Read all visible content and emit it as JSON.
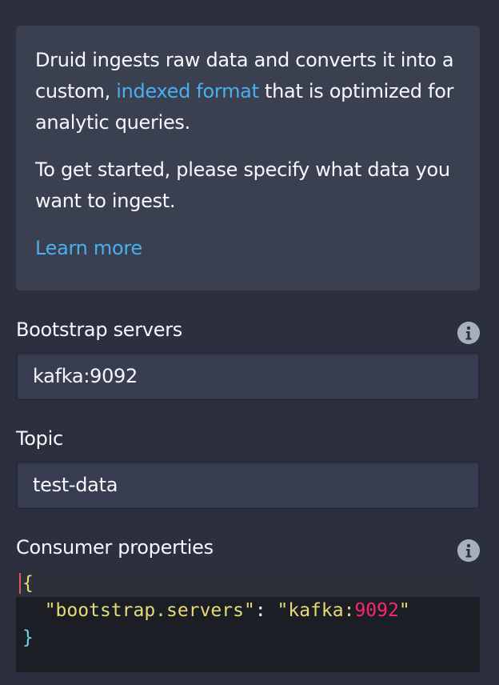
{
  "callout": {
    "intro_before_link": "Druid ingests raw data and converts it into a custom, ",
    "intro_link": "indexed format",
    "intro_after_link": " that is optimized for analytic queries.",
    "get_started": "To get started, please specify what data you want to ingest.",
    "learn_more": "Learn more"
  },
  "fields": {
    "bootstrap_servers": {
      "label": "Bootstrap servers",
      "value": "kafka:9092"
    },
    "topic": {
      "label": "Topic",
      "value": "test-data"
    },
    "consumer_properties": {
      "label": "Consumer properties",
      "code": {
        "open_brace": "{",
        "key": "\"bootstrap.servers\"",
        "colon": ": ",
        "value_host": "\"kafka:",
        "value_port": "9092",
        "value_end": "\"",
        "close_brace": "}"
      }
    }
  },
  "icons": {
    "info": "info-circle-icon"
  },
  "colors": {
    "background": "#2b2f3e",
    "callout_background": "#3b4050",
    "link": "#48aff0",
    "input_background": "#383d51",
    "editor_background": "#1c1e26",
    "json_string": "#e6db74",
    "json_number": "#f92672",
    "json_brace": "#66d9ef"
  }
}
